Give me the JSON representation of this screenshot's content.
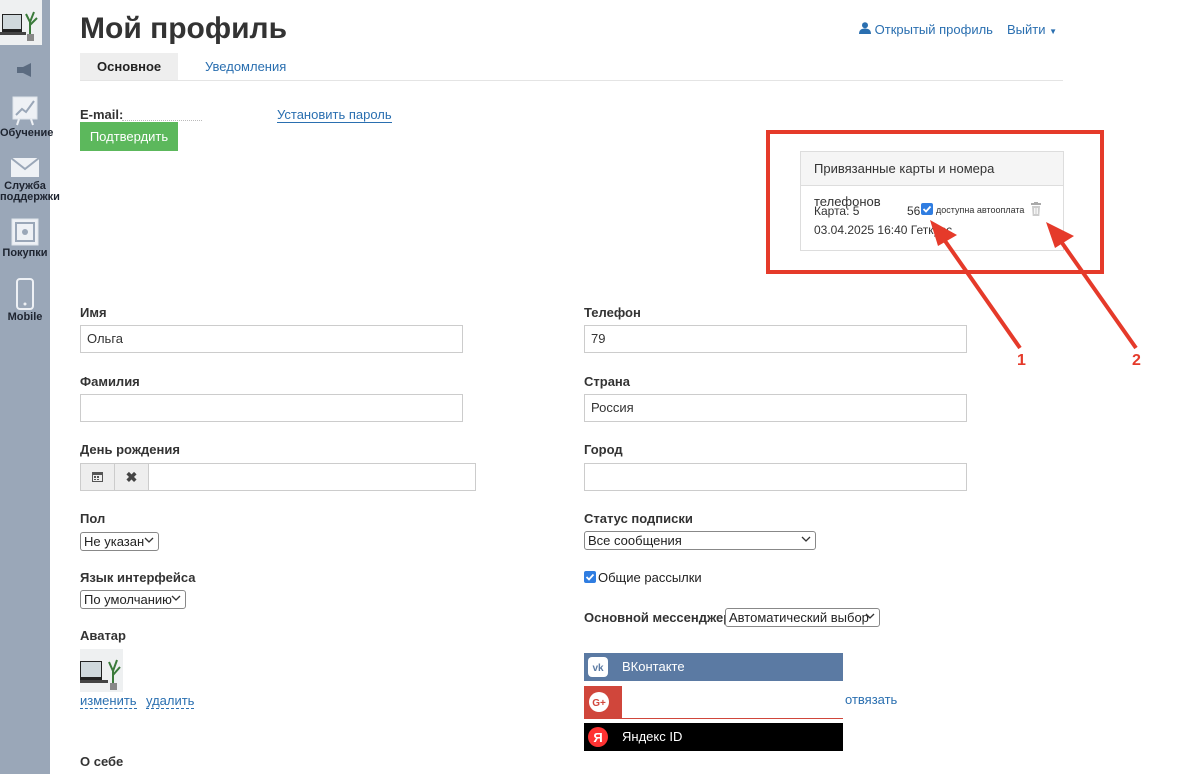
{
  "sidebar": {
    "items": [
      {
        "label": ""
      },
      {
        "label": "Обучение"
      },
      {
        "label": "Служба\nподдержки"
      },
      {
        "label": "Покупки"
      },
      {
        "label": "Mobile"
      }
    ]
  },
  "header": {
    "title": "Мой профиль",
    "public_profile": "Открытый профиль",
    "logout": "Выйти"
  },
  "tabs": [
    {
      "label": "Основное",
      "active": true
    },
    {
      "label": "Уведомления",
      "active": false
    }
  ],
  "email": {
    "label": "E-mail:",
    "set_password": "Установить пароль",
    "confirm_button": "Подтвердить"
  },
  "cards_panel": {
    "title": "Привязанные карты и номера телефонов",
    "card_label": "Карта: 5",
    "card_suffix": "56",
    "autopay_label": "доступна автооплата",
    "autopay_checked": true,
    "added": "03.04.2025 16:40 Геткурс"
  },
  "annotations": {
    "marker_1": "1",
    "marker_2": "2"
  },
  "form": {
    "first_name": {
      "label": "Имя",
      "value": "Ольга"
    },
    "last_name": {
      "label": "Фамилия",
      "value": ""
    },
    "birthday": {
      "label": "День рождения",
      "value": ""
    },
    "gender": {
      "label": "Пол",
      "value": "Не указан"
    },
    "language": {
      "label": "Язык интерфейса",
      "value": "По умолчанию"
    },
    "avatar": {
      "label": "Аватар",
      "change": "изменить",
      "delete": "удалить"
    },
    "about": {
      "label": "О себе"
    },
    "phone": {
      "label": "Телефон",
      "value": "79"
    },
    "country": {
      "label": "Страна",
      "value": "Россия"
    },
    "city": {
      "label": "Город",
      "value": ""
    },
    "subscription": {
      "label": "Статус подписки",
      "value": "Все сообщения"
    },
    "newsletters": {
      "label": "Общие рассылки",
      "checked": true
    },
    "messenger": {
      "label": "Основной мессенджер",
      "value": "Автоматический выбор"
    }
  },
  "social": {
    "vk": {
      "label": "ВКонтакте",
      "color": "#5b7aa3"
    },
    "google": {
      "label": "",
      "color": "#d0463b",
      "unlink": "отвязать"
    },
    "yandex": {
      "label": "Яндекс ID",
      "color": "#000000"
    }
  },
  "colors": {
    "accent_link": "#2a6fb0",
    "confirm_green": "#5cb85c",
    "annotation_red": "#e53a2a",
    "sidebar": "#9aa7b8"
  }
}
